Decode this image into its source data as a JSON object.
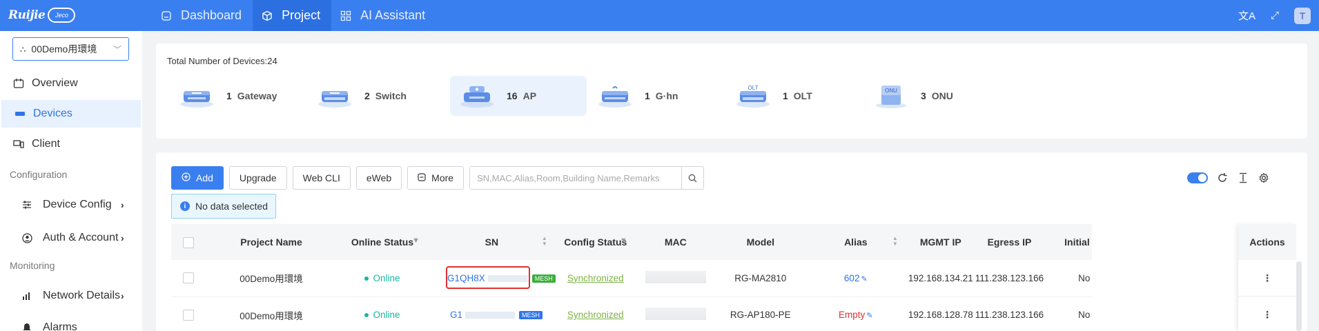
{
  "brand": {
    "logo_text": "Ruijie",
    "cloud_text": "Jeco"
  },
  "nav": {
    "items": [
      {
        "label": "Dashboard",
        "icon": "home-icon",
        "active": false
      },
      {
        "label": "Project",
        "icon": "cube-icon",
        "active": true
      },
      {
        "label": "AI Assistant",
        "icon": "grid-icon",
        "active": false
      }
    ]
  },
  "topbar_right": {
    "avatar": "T",
    "icons": [
      "translate-icon",
      "fullscreen-icon"
    ]
  },
  "sidebar": {
    "project_select": "00Demo用環境",
    "items": [
      {
        "label": "Overview",
        "icon": "calendar-icon"
      },
      {
        "label": "Devices",
        "icon": "device-icon",
        "active": true
      },
      {
        "label": "Client",
        "icon": "client-icon"
      }
    ],
    "group_configuration": "Configuration",
    "config_items": [
      {
        "label": "Device Config",
        "icon": "sliders-icon"
      },
      {
        "label": "Auth & Account",
        "icon": "user-circle-icon"
      }
    ],
    "group_monitoring": "Monitoring",
    "monitor_items": [
      {
        "label": "Network Details",
        "icon": "bar-chart-icon"
      },
      {
        "label": "Alarms",
        "icon": "bell-icon"
      }
    ]
  },
  "summary": {
    "total_label": "Total Number of Devices:24",
    "devices": [
      {
        "count": "1",
        "name": "Gateway",
        "icon": "gateway-icon",
        "tag": ""
      },
      {
        "count": "2",
        "name": "Switch",
        "icon": "switch-icon",
        "tag": ""
      },
      {
        "count": "16",
        "name": "AP",
        "icon": "ap-icon",
        "tag": "",
        "active": true
      },
      {
        "count": "1",
        "name": "G·hn",
        "icon": "ghn-icon",
        "tag": ""
      },
      {
        "count": "1",
        "name": "OLT",
        "icon": "olt-icon",
        "tag": "OLT"
      },
      {
        "count": "3",
        "name": "ONU",
        "icon": "onu-icon",
        "tag": "ONU"
      }
    ]
  },
  "toolbar": {
    "add": "Add",
    "upgrade": "Upgrade",
    "webcli": "Web CLI",
    "eweb": "eWeb",
    "more": "More",
    "search_placeholder": "SN,MAC,Alias,Room,Building Name,Remarks"
  },
  "selection_info": "No data selected",
  "table": {
    "headers": {
      "project": "Project Name",
      "online": "Online Status",
      "sn": "SN",
      "config": "Config Status",
      "mac": "MAC",
      "model": "Model",
      "alias": "Alias",
      "mgmt_ip": "MGMT IP",
      "egress_ip": "Egress IP",
      "initial": "Initial",
      "actions": "Actions"
    },
    "rows": [
      {
        "project": "00Demo用環境",
        "online": "Online",
        "sn": "G1QH8X",
        "mesh": "MESH",
        "config": "Synchronized",
        "model": "RG-MA2810",
        "alias": "602",
        "alias_empty": false,
        "mgmt_ip": "192.168.134.21",
        "egress_ip": "111.238.123.166",
        "initial": "No"
      },
      {
        "project": "00Demo用環境",
        "online": "Online",
        "sn": "G1",
        "mesh": "MESH",
        "config": "Synchronized",
        "model": "RG-AP180-PE",
        "alias": "Empty",
        "alias_empty": true,
        "mgmt_ip": "192.168.128.78",
        "egress_ip": "111.238.123.166",
        "initial": "No"
      }
    ]
  }
}
